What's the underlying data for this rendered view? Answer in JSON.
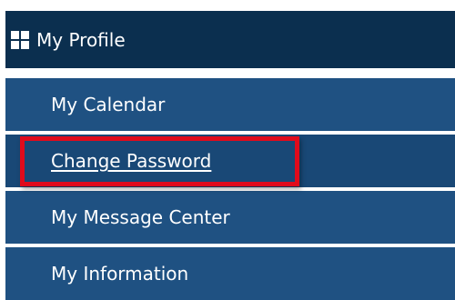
{
  "header": {
    "icon": "grid-icon",
    "label": "My Profile"
  },
  "menu": {
    "items": [
      {
        "label": "My Calendar"
      },
      {
        "label": "Change Password",
        "active": true
      },
      {
        "label": "My Message Center"
      },
      {
        "label": "My Information"
      }
    ]
  },
  "colors": {
    "header_bg": "#0b2f4f",
    "item_bg": "#1f5182",
    "active_bg": "#194876",
    "highlight": "#e00b1c",
    "text": "#ffffff"
  }
}
